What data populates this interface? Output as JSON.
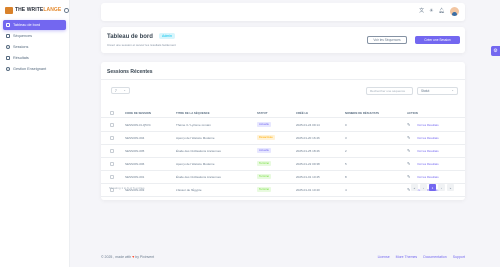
{
  "brand": {
    "part1": "THE WRITE",
    "part2": "LANGE"
  },
  "sidebar": {
    "items": [
      {
        "label": "Tableau de bord",
        "active": true
      },
      {
        "label": "Séquences",
        "active": false
      },
      {
        "label": "Sessions",
        "active": false
      },
      {
        "label": "Résultats",
        "active": false
      },
      {
        "label": "Gestion Enseignant",
        "active": false
      }
    ]
  },
  "topbar": {
    "icons": [
      "language-icon",
      "theme-icon",
      "notification-icon"
    ]
  },
  "header": {
    "title": "Tableau de bord",
    "badge": "Admin",
    "subtitle": "Créez une session et suivez les résultats facilement",
    "btn_secondary": "Voir les Séquences",
    "btn_primary": "Créer une Session"
  },
  "sessions": {
    "title": "Sessions Récentes",
    "page_size": "7",
    "search_placeholder": "Rechercher une séquence",
    "filter_value": "Statut",
    "columns": [
      "CODE DE SESSION",
      "TITRE DE LA SÉQUENCE",
      "STATUT",
      "CRÉÉ LE",
      "NOMBRE DE RÉSULTATS",
      "ACTION"
    ],
    "rows": [
      {
        "code": "SESSION-FLQ5V4",
        "title": "Thème 3 / Lyrisme romain",
        "status": "Actuelle",
        "status_kind": "purple",
        "date": "2025-01-24 09:14",
        "count": "0",
        "action": "Voir les Résultats"
      },
      {
        "code": "SESSION-004",
        "title": "Aperçu de l'Histoire Moderne",
        "status": "Désactivée",
        "status_kind": "orange",
        "date": "2025-01-20 16:46",
        "count": "3",
        "action": "Voir les Résultats"
      },
      {
        "code": "SESSION-005",
        "title": "Étude des Civilisations Anciennes",
        "status": "Actuelle",
        "status_kind": "purple",
        "date": "2025-01-25 18:46",
        "count": "2",
        "action": "Voir les Résultats"
      },
      {
        "code": "SESSION-006",
        "title": "Aperçu de l'Histoire Moderne",
        "status": "Terminé",
        "status_kind": "green",
        "date": "2025-01-22 09:38",
        "count": "5",
        "action": "Voir les Résultats"
      },
      {
        "code": "SESSION-001",
        "title": "Étude des Civilisations Anciennes",
        "status": "Terminé",
        "status_kind": "green",
        "date": "2025-01-01 10:45",
        "count": "8",
        "action": "Voir les Résultats"
      },
      {
        "code": "SESSION-003",
        "title": "L'Essor de l'Égypte",
        "status": "Terminé",
        "status_kind": "green",
        "date": "2025-01-01 10:40",
        "count": "4",
        "action": "Voir les Résultats"
      }
    ],
    "showing": "Showing 1 to 6 of 6 entries",
    "pager": [
      "«",
      "‹",
      "1",
      "›",
      "»"
    ],
    "active_page": "1"
  },
  "footer": {
    "copyright": "© 2025 , made with",
    "by": "by Pixinvent",
    "links": [
      "License",
      "More Themes",
      "Documentation",
      "Support"
    ]
  },
  "colors": {
    "primary": "#7367f0",
    "purple_bg": "#e7e7ff",
    "purple_fg": "#7367f0",
    "orange_bg": "#fff2d6",
    "orange_fg": "#ffab00",
    "green_bg": "#e8fadf",
    "green_fg": "#71dd37"
  }
}
